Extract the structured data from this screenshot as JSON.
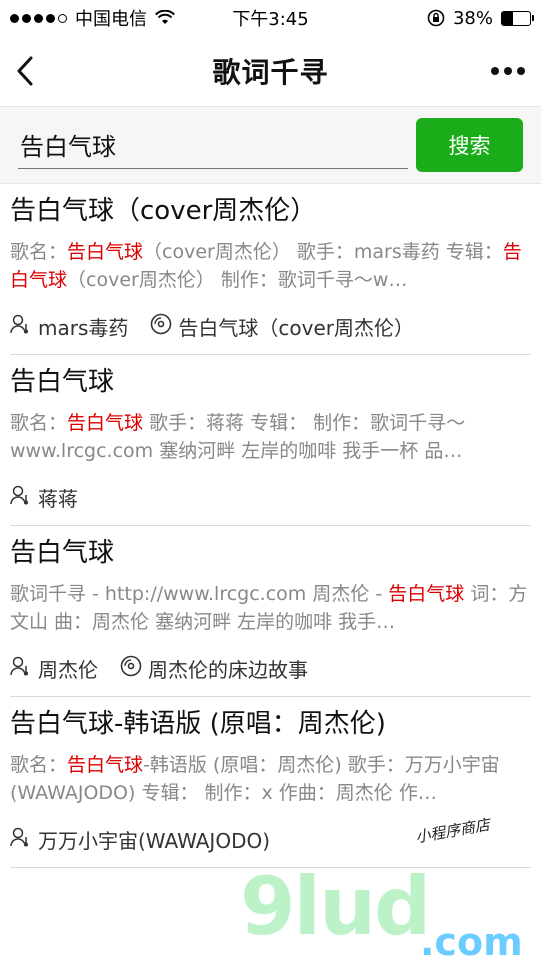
{
  "status": {
    "carrier": "中国电信",
    "time": "下午3:45",
    "battery": "38%",
    "battery_level": 0.38
  },
  "nav": {
    "title": "歌词千寻"
  },
  "search": {
    "value": "告白气球",
    "button": "搜索"
  },
  "results": [
    {
      "title": "告白气球（cover周杰伦）",
      "snippet": [
        {
          "t": "歌名：",
          "h": false
        },
        {
          "t": "告白气球",
          "h": true
        },
        {
          "t": "（cover周杰伦） 歌手：mars毒药 专辑：",
          "h": false
        },
        {
          "t": "告白气球",
          "h": true
        },
        {
          "t": "（cover周杰伦） 制作：歌词千寻～w…",
          "h": false
        }
      ],
      "singer": "mars毒药",
      "album": "告白气球（cover周杰伦）"
    },
    {
      "title": "告白气球",
      "snippet": [
        {
          "t": "歌名：",
          "h": false
        },
        {
          "t": "告白气球",
          "h": true
        },
        {
          "t": " 歌手：蒋蒋 专辑： 制作：歌词千寻～www.lrcgc.com 塞纳河畔 左岸的咖啡 我手一杯 品…",
          "h": false
        }
      ],
      "singer": "蒋蒋",
      "album": ""
    },
    {
      "title": "告白气球",
      "snippet": [
        {
          "t": "歌词千寻 - http://www.lrcgc.com 周杰伦 - ",
          "h": false
        },
        {
          "t": "告白气球",
          "h": true
        },
        {
          "t": " 词：方文山 曲：周杰伦 塞纳河畔 左岸的咖啡 我手…",
          "h": false
        }
      ],
      "singer": "周杰伦",
      "album": "周杰伦的床边故事"
    },
    {
      "title": "告白气球-韩语版 (原唱：周杰伦)",
      "snippet": [
        {
          "t": "歌名：",
          "h": false
        },
        {
          "t": "告白气球",
          "h": true
        },
        {
          "t": "-韩语版 (原唱：周杰伦) 歌手：万万小宇宙(WAWAJODO) 专辑： 制作：x 作曲：周杰伦 作…",
          "h": false
        }
      ],
      "singer": "万万小宇宙(WAWAJODO)",
      "album": ""
    }
  ],
  "watermark": {
    "main": "9lud",
    "com": ".com",
    "sub": "小程序商店"
  },
  "colors": {
    "highlight": "#dd0000",
    "button": "#1aad19"
  }
}
